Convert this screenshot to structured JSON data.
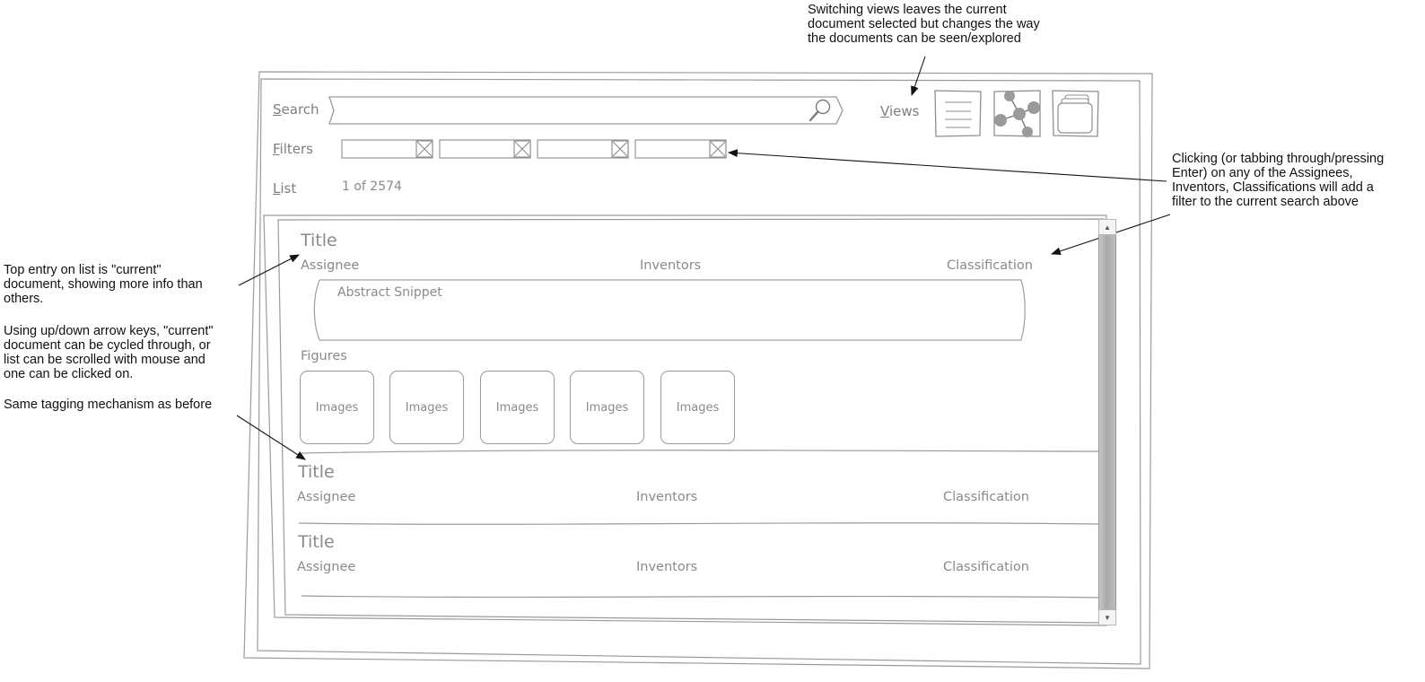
{
  "annotations": {
    "views_note": [
      "Switching views leaves the current",
      "document selected but changes the way",
      "the documents can be seen/explored"
    ],
    "filter_note": [
      "Clicking (or tabbing through/pressing",
      "Enter) on any of the Assignees,",
      "Inventors, Classifications will add a",
      "filter to the current search above"
    ],
    "current_note": [
      "Top entry on list is \"current\"",
      "document, showing more info than",
      "others."
    ],
    "cycle_note": [
      "Using up/down arrow keys, \"current\"",
      "document can be cycled through, or",
      "list can be scrolled with mouse and",
      "one can be clicked on."
    ],
    "tagging_note": "Same tagging mechanism as before"
  },
  "header": {
    "search_label_first": "S",
    "search_label_rest": "earch",
    "views_label_first": "V",
    "views_label_rest": "iews",
    "filters_label_first": "F",
    "filters_label_rest": "ilters",
    "list_label_first": "L",
    "list_label_rest": "ist",
    "list_count": "1 of 2574",
    "search_value": "",
    "views": [
      {
        "name": "list-view-icon"
      },
      {
        "name": "graph-view-icon"
      },
      {
        "name": "stack-view-icon"
      }
    ],
    "filters": [
      "",
      "",
      "",
      ""
    ]
  },
  "documents": [
    {
      "title": "Title",
      "assignee": "Assignee",
      "inventors": "Inventors",
      "classification": "Classification",
      "abstract": "Abstract Snippet",
      "figures_label": "Figures",
      "images": [
        "Images",
        "Images",
        "Images",
        "Images",
        "Images"
      ]
    },
    {
      "title": "Title",
      "assignee": "Assignee",
      "inventors": "Inventors",
      "classification": "Classification"
    },
    {
      "title": "Title",
      "assignee": "Assignee",
      "inventors": "Inventors",
      "classification": "Classification"
    }
  ]
}
